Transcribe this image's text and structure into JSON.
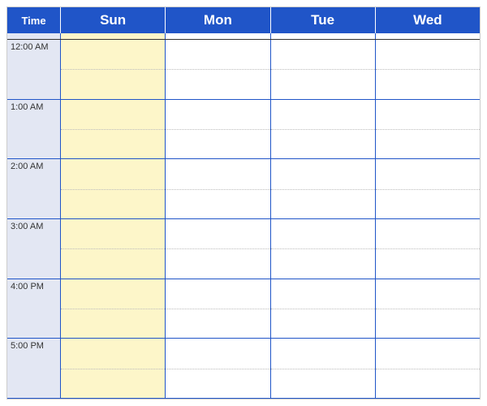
{
  "header": {
    "time_label": "Time",
    "days": [
      "Sun",
      "Mon",
      "Tue",
      "Wed"
    ]
  },
  "hours": [
    {
      "label": "12:00 AM"
    },
    {
      "label": "1:00 AM"
    },
    {
      "label": "2:00 AM"
    },
    {
      "label": "3:00 AM"
    },
    {
      "label": "4:00 PM"
    },
    {
      "label": "5:00 PM"
    }
  ],
  "highlighted_day_index": 0
}
